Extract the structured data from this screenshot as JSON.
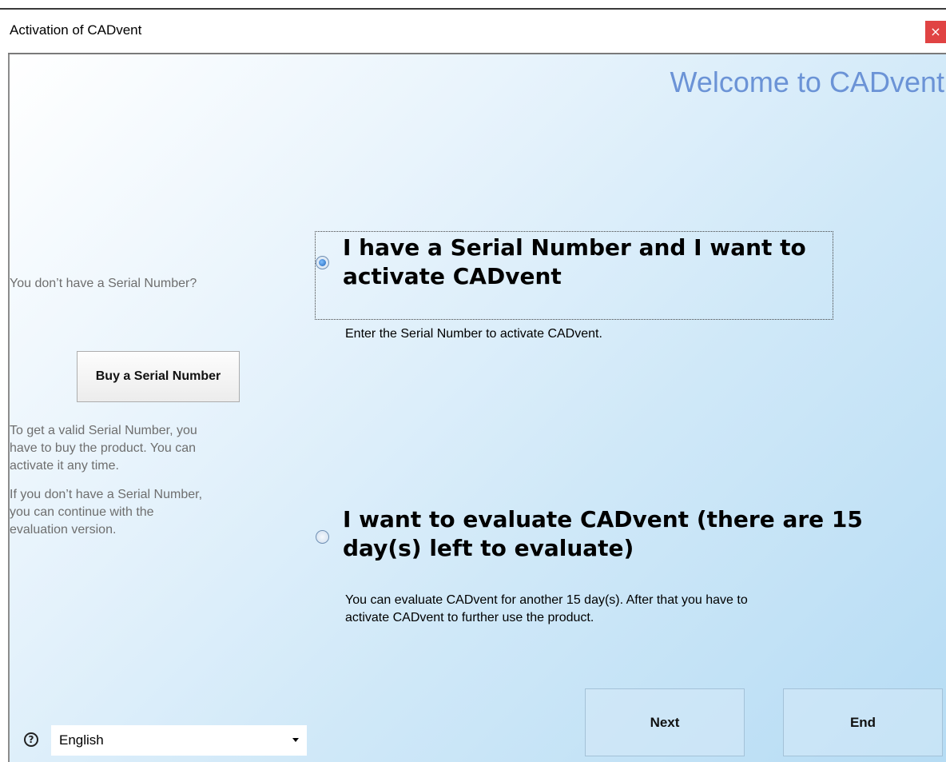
{
  "window": {
    "title": "Activation of CADvent",
    "close_label": "×"
  },
  "header": {
    "welcome": "Welcome to CADvent"
  },
  "sidebar": {
    "no_serial_question": "You don’t have a Serial Number?",
    "buy_button": "Buy a Serial Number",
    "info_lines_1": [
      "To get a valid Serial Number, you",
      "have to buy the product. You can",
      "activate it any time."
    ],
    "info_lines_2": [
      "If you don’t have a Serial Number,",
      "you can continue with the",
      "evaluation version."
    ]
  },
  "options": {
    "serial": {
      "title_lines": [
        "I have a Serial Number and I want to",
        "activate CADvent"
      ],
      "description": "Enter the Serial Number to activate CADvent.",
      "selected": true
    },
    "evaluate": {
      "title_lines": [
        "I want to evaluate CADvent (there are 15",
        "day(s) left to evaluate)"
      ],
      "description_lines": [
        "You can evaluate CADvent for another 15 day(s). After that you have to",
        "activate CADvent to further use the product."
      ],
      "selected": false
    }
  },
  "footer": {
    "language": "English",
    "next_label": "Next",
    "end_label": "End"
  },
  "icons": {
    "help": "help-icon",
    "close": "close-icon",
    "dropdown": "chevron-down-icon"
  },
  "colors": {
    "welcome_text": "#6b93d6",
    "close_button": "#e04343"
  }
}
